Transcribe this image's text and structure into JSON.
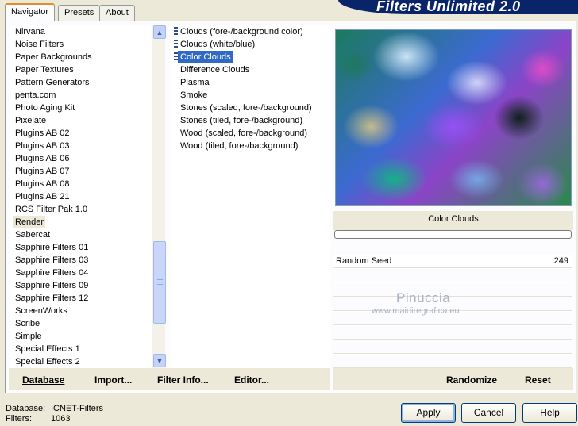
{
  "tabs": [
    {
      "label": "Navigator",
      "active": true
    },
    {
      "label": "Presets",
      "active": false
    },
    {
      "label": "About",
      "active": false
    }
  ],
  "app_title": "Filters Unlimited 2.0",
  "categories": {
    "items": [
      "Nirvana",
      "Noise Filters",
      "Paper Backgrounds",
      "Paper Textures",
      "Pattern Generators",
      "penta.com",
      "Photo Aging Kit",
      "Pixelate",
      "Plugins AB 02",
      "Plugins AB 03",
      "Plugins AB 06",
      "Plugins AB 07",
      "Plugins AB 08",
      "Plugins AB 21",
      "RCS Filter Pak 1.0",
      "Render",
      "Sabercat",
      "Sapphire Filters 01",
      "Sapphire Filters 03",
      "Sapphire Filters 04",
      "Sapphire Filters 09",
      "Sapphire Filters 12",
      "ScreenWorks",
      "Scribe",
      "Simple",
      "Special Effects 1",
      "Special Effects 2"
    ],
    "selected": "Render"
  },
  "filters": {
    "items": [
      "Clouds (fore-/background color)",
      "Clouds (white/blue)",
      "Color Clouds",
      "Difference Clouds",
      "Plasma",
      "Smoke",
      "Stones (scaled, fore-/background)",
      "Stones (tiled, fore-/background)",
      "Wood (scaled, fore-/background)",
      "Wood (tiled, fore-/background)"
    ],
    "selected": "Color Clouds"
  },
  "preview": {
    "filter_name": "Color Clouds",
    "progress": 0
  },
  "params": [
    {
      "label": "Random Seed",
      "value": "249"
    }
  ],
  "watermark": {
    "name": "Pinuccia",
    "url": "www.maidiregrafica.eu"
  },
  "left_bar": {
    "database": "Database",
    "import": "Import...",
    "filter_info": "Filter Info...",
    "editor": "Editor..."
  },
  "right_bar": {
    "randomize": "Randomize",
    "reset": "Reset"
  },
  "footer": {
    "database_label": "Database:",
    "database_value": "ICNET-Filters",
    "filters_label": "Filters:",
    "filters_value": "1063"
  },
  "buttons": {
    "apply": "Apply",
    "cancel": "Cancel",
    "help": "Help"
  }
}
